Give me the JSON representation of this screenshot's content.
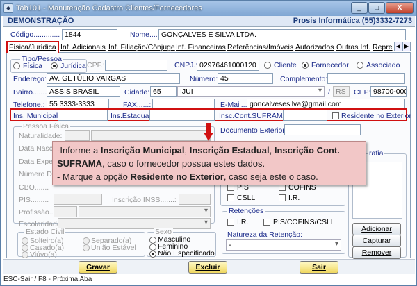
{
  "window": {
    "title": "Tab101 - Manutenção Cadastro Clientes/Fornecedores",
    "title_icon": "app-icon",
    "btn_min": "_",
    "btn_max": "□",
    "btn_close": "X"
  },
  "header": {
    "left": "DEMONSTRAÇÃO",
    "right": "Prosis Informática (55)3332-7273"
  },
  "top": {
    "codigo_label": "Código.............",
    "codigo_value": "1844",
    "nome_label": "Nome.....:",
    "nome_value": "GONÇALVES E SILVA LTDA."
  },
  "tabs": [
    {
      "label": "Física/Jurídica"
    },
    {
      "label": "Inf. Adicionais"
    },
    {
      "label": "Inf. Filiação/Cônjuge"
    },
    {
      "label": "Inf. Financeiras"
    },
    {
      "label": "Referências/Imóveis"
    },
    {
      "label": "Autorizados"
    },
    {
      "label": "Outras Inf."
    },
    {
      "label": "Repre"
    }
  ],
  "tab_scroll": {
    "left": "◀",
    "right": "▶"
  },
  "form": {
    "tipo_pessoa": "Tipo/Pessoa",
    "fisica": "Física",
    "juridica": "Jurídica",
    "cpf_label": "CPF.:",
    "cnpj_label": "CNPJ.:",
    "cnpj_value": "02976461000120",
    "cliente": "Cliente",
    "fornecedor": "Fornecedor",
    "associado": "Associado",
    "endereco_label": "Endereço:",
    "endereco_value": "AV. GETÚLIO VARGAS",
    "numero_label": "Número:",
    "numero_value": "45",
    "complemento_label": "Complemento:",
    "bairro_label": "Bairro.......:",
    "bairro_value": "ASSIS BRASIL",
    "cidade_label": "Cidade:",
    "cidade_code": "65",
    "cidade_value": "IJUI",
    "uf_sep": "/",
    "uf_value": "RS",
    "cep_label": "CEP:",
    "cep_value": "98700-000",
    "telefone_label": "Telefone.:",
    "telefone_value": "55 3333-3333",
    "fax_label": "FAX......:",
    "email_label": "E-Mail.....:",
    "email_value": "goncalvesesilva@gmail.com",
    "ins_municipal_label": "Ins. Municipal:",
    "ins_estadual_label": "Ins.Estadual:",
    "suframa_label": "Insc.Cont.SUFRAMA:",
    "residente_label": "Residente no Exterior",
    "pessoa_fisica": "Pessoa Física",
    "naturalidade": "Naturalidade:",
    "data_nasc": "Data Nasci",
    "data_exp": "Data Expe",
    "numero_de": "Número De",
    "cbo": "CBO.......",
    "pis": "PIS.........",
    "inscricao_inss": "Inscrição INSS.......:",
    "profissao": "Profissão..:",
    "escolaridade": "Escolaridade:",
    "estado_civil": "Estado Civil",
    "solteiro": "Solteiro(a)",
    "casado": "Casado(a)",
    "viuvo": "Viúvo(a)",
    "separado": "Separado(a)",
    "uniao": "União Estável",
    "sexo": "Sexo",
    "masculino": "Masculino",
    "feminino": "Feminino",
    "nao_esp": "Não Especificado",
    "documento_exterior": "Documento Exterior.:",
    "fotografia": "rafia",
    "pis_chk": "PIS",
    "cofins_chk": "COFINS",
    "csll_chk": "CSLL",
    "ir_chk": "I.R.",
    "retencoes": "Retenções",
    "ret_ir": "I.R.",
    "ret_pis": "PIS/COFINS/CSLL",
    "natureza": "Natureza da Retenção:",
    "natureza_value": "-",
    "adicionar": "Adicionar",
    "capturar": "Capturar",
    "remover": "Remover"
  },
  "callout": {
    "l1a": "-Informe a ",
    "l1b": "Inscrição Municipal",
    "l1c": ", ",
    "l1d": "Inscrição Estadual",
    "l1e": ",  ",
    "l1f": "Inscrição Cont.",
    "l2a": "SUFRAMA",
    "l2b": ", caso o fornecedor possua estes dados.",
    "l3a": "- Marque a opção ",
    "l3b": "Residente no Exterior",
    "l3c": ", caso seja este o caso."
  },
  "footer": {
    "gravar": "Gravar",
    "excluir": "Excluir",
    "sair": "Sair"
  },
  "status": "ESC-Sair / F8 - Próxima Aba",
  "colors": {
    "accent": "#1a3a7a",
    "highlight": "#d01010",
    "callout_bg": "#f2c7c7"
  }
}
